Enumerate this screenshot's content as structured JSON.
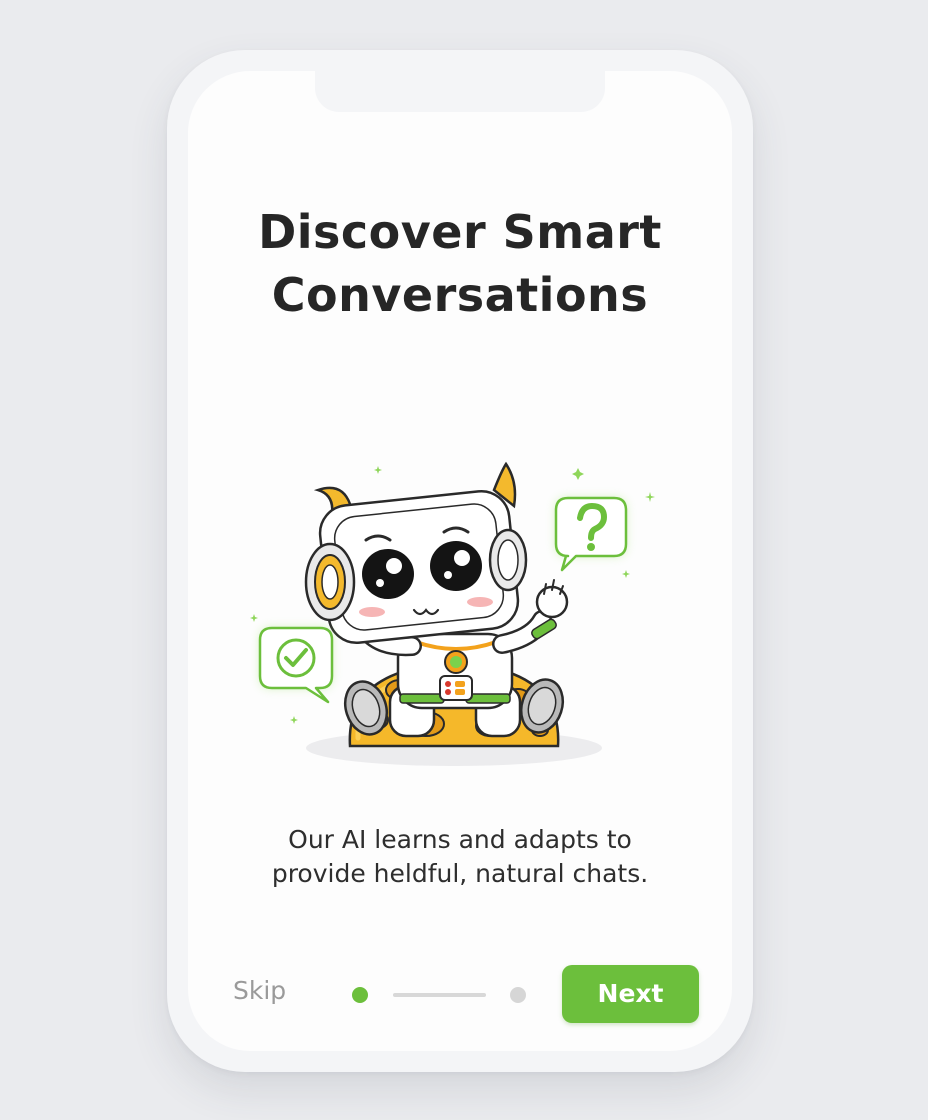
{
  "onboarding": {
    "title_line1": "Discover Smart",
    "title_line2": "Conversations",
    "description_line1": "Our AI learns and adapts to",
    "description_line2": "provide heldful, natural chats.",
    "skip_label": "Skip",
    "next_label": "Next",
    "page_indicator": {
      "current_page": 1,
      "total_pages": 2
    },
    "illustration": {
      "subject": "robot-astronaut-on-moon",
      "icons": [
        "check-mark-icon",
        "question-mark-icon",
        "sparkle-icon"
      ]
    }
  },
  "colors": {
    "accent": "#6cbf3c",
    "title_text": "#262626",
    "body_text": "#2e2e2e",
    "muted_text": "#9a9a9a",
    "inactive_dot": "#d6d6d6",
    "moon": "#f5b82a",
    "horn": "#f3b92d",
    "background": "#eaebee",
    "screen": "#fdfdfd"
  }
}
